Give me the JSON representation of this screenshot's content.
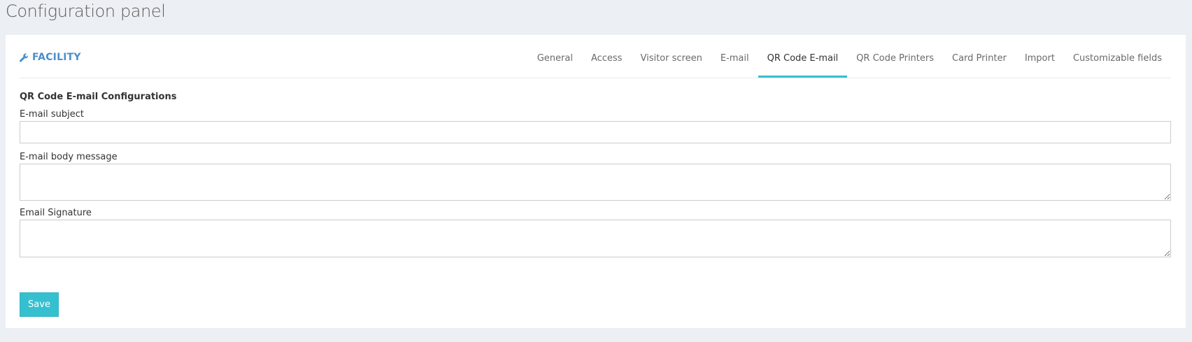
{
  "page": {
    "title": "Configuration panel"
  },
  "panel": {
    "title": "FACILITY",
    "title_icon": "wrench-icon",
    "accent_color": "#4a8fcf",
    "active_tab_color": "#35c0d0",
    "tabs": [
      {
        "label": "General",
        "active": false
      },
      {
        "label": "Access",
        "active": false
      },
      {
        "label": "Visitor screen",
        "active": false
      },
      {
        "label": "E-mail",
        "active": false
      },
      {
        "label": "QR Code E-mail",
        "active": true
      },
      {
        "label": "QR Code Printers",
        "active": false
      },
      {
        "label": "Card Printer",
        "active": false
      },
      {
        "label": "Import",
        "active": false
      },
      {
        "label": "Customizable fields",
        "active": false
      }
    ]
  },
  "form": {
    "section_title": "QR Code E-mail Configurations",
    "fields": {
      "subject": {
        "label": "E-mail subject",
        "value": ""
      },
      "body": {
        "label": "E-mail body message",
        "value": ""
      },
      "signature": {
        "label": "Email Signature",
        "value": ""
      }
    },
    "save_label": "Save",
    "save_color": "#35c0d0"
  }
}
